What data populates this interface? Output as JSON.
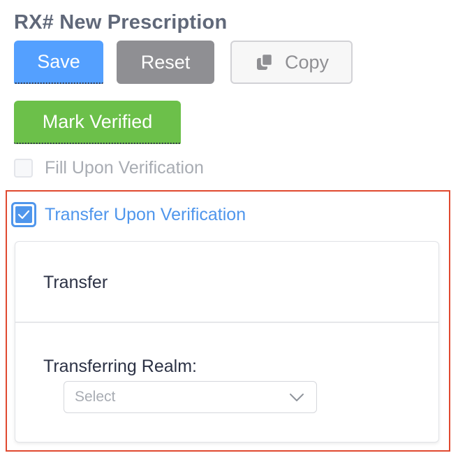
{
  "header": {
    "title": "RX# New Prescription"
  },
  "toolbar": {
    "save_label": "Save",
    "reset_label": "Reset",
    "copy_label": "Copy",
    "copy_icon": "copy-icon",
    "mark_verified_label": "Mark Verified"
  },
  "options": {
    "fill_upon_verification": {
      "label": "Fill Upon Verification",
      "checked": false
    },
    "transfer_upon_verification": {
      "label": "Transfer Upon Verification",
      "checked": true
    }
  },
  "transfer_card": {
    "title": "Transfer",
    "realm_label": "Transferring Realm:",
    "realm_select": {
      "placeholder": "Select",
      "icon": "chevron-down-icon"
    }
  },
  "colors": {
    "primary": "#54a0ff",
    "neutral": "#8f8f93",
    "success": "#6cc04a",
    "link": "#4f96ec",
    "highlight_border": "#e0492f"
  }
}
